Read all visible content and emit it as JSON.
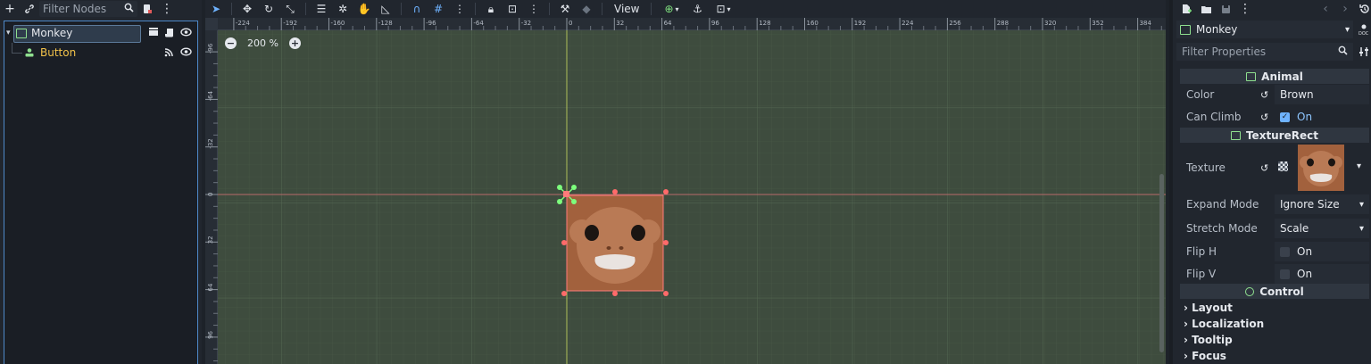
{
  "scene_dock": {
    "filter_placeholder": "Filter Nodes",
    "nodes": [
      {
        "label": "Monkey",
        "color": "#e6e9ee",
        "selected": true
      },
      {
        "label": "Button",
        "color": "#f2c24a",
        "selected": false
      }
    ]
  },
  "viewport_toolbar": {
    "view_label": "View"
  },
  "viewport": {
    "zoom_label": "200 %",
    "ruler_top_labels": [
      "-224",
      "-192",
      "-160",
      "-128",
      "-96",
      "-64",
      "-32",
      "0",
      "32",
      "64",
      "96",
      "128",
      "160",
      "192",
      "224",
      "256",
      "288",
      "320",
      "352",
      "384"
    ],
    "ruler_left_labels": [
      "-96",
      "-64",
      "-32",
      "0",
      "32",
      "64",
      "96"
    ],
    "colors": {
      "background": "#3e4c3e",
      "texture": "#a2613d",
      "selection": "#ff6a6a",
      "pivot": "#7dff7d"
    }
  },
  "inspector": {
    "object_name": "Monkey",
    "filter_placeholder": "Filter Properties",
    "sections": {
      "animal": "Animal",
      "texture_rect": "TextureRect",
      "control": "Control"
    },
    "props": {
      "color_label": "Color",
      "color_value": "Brown",
      "can_climb_label": "Can Climb",
      "can_climb_value": "On",
      "texture_label": "Texture",
      "expand_mode_label": "Expand Mode",
      "expand_mode_value": "Ignore Size",
      "stretch_mode_label": "Stretch Mode",
      "stretch_mode_value": "Scale",
      "flip_h_label": "Flip H",
      "flip_h_value": "On",
      "flip_v_label": "Flip V",
      "flip_v_value": "On"
    },
    "groups": [
      "Layout",
      "Localization",
      "Tooltip",
      "Focus"
    ]
  }
}
